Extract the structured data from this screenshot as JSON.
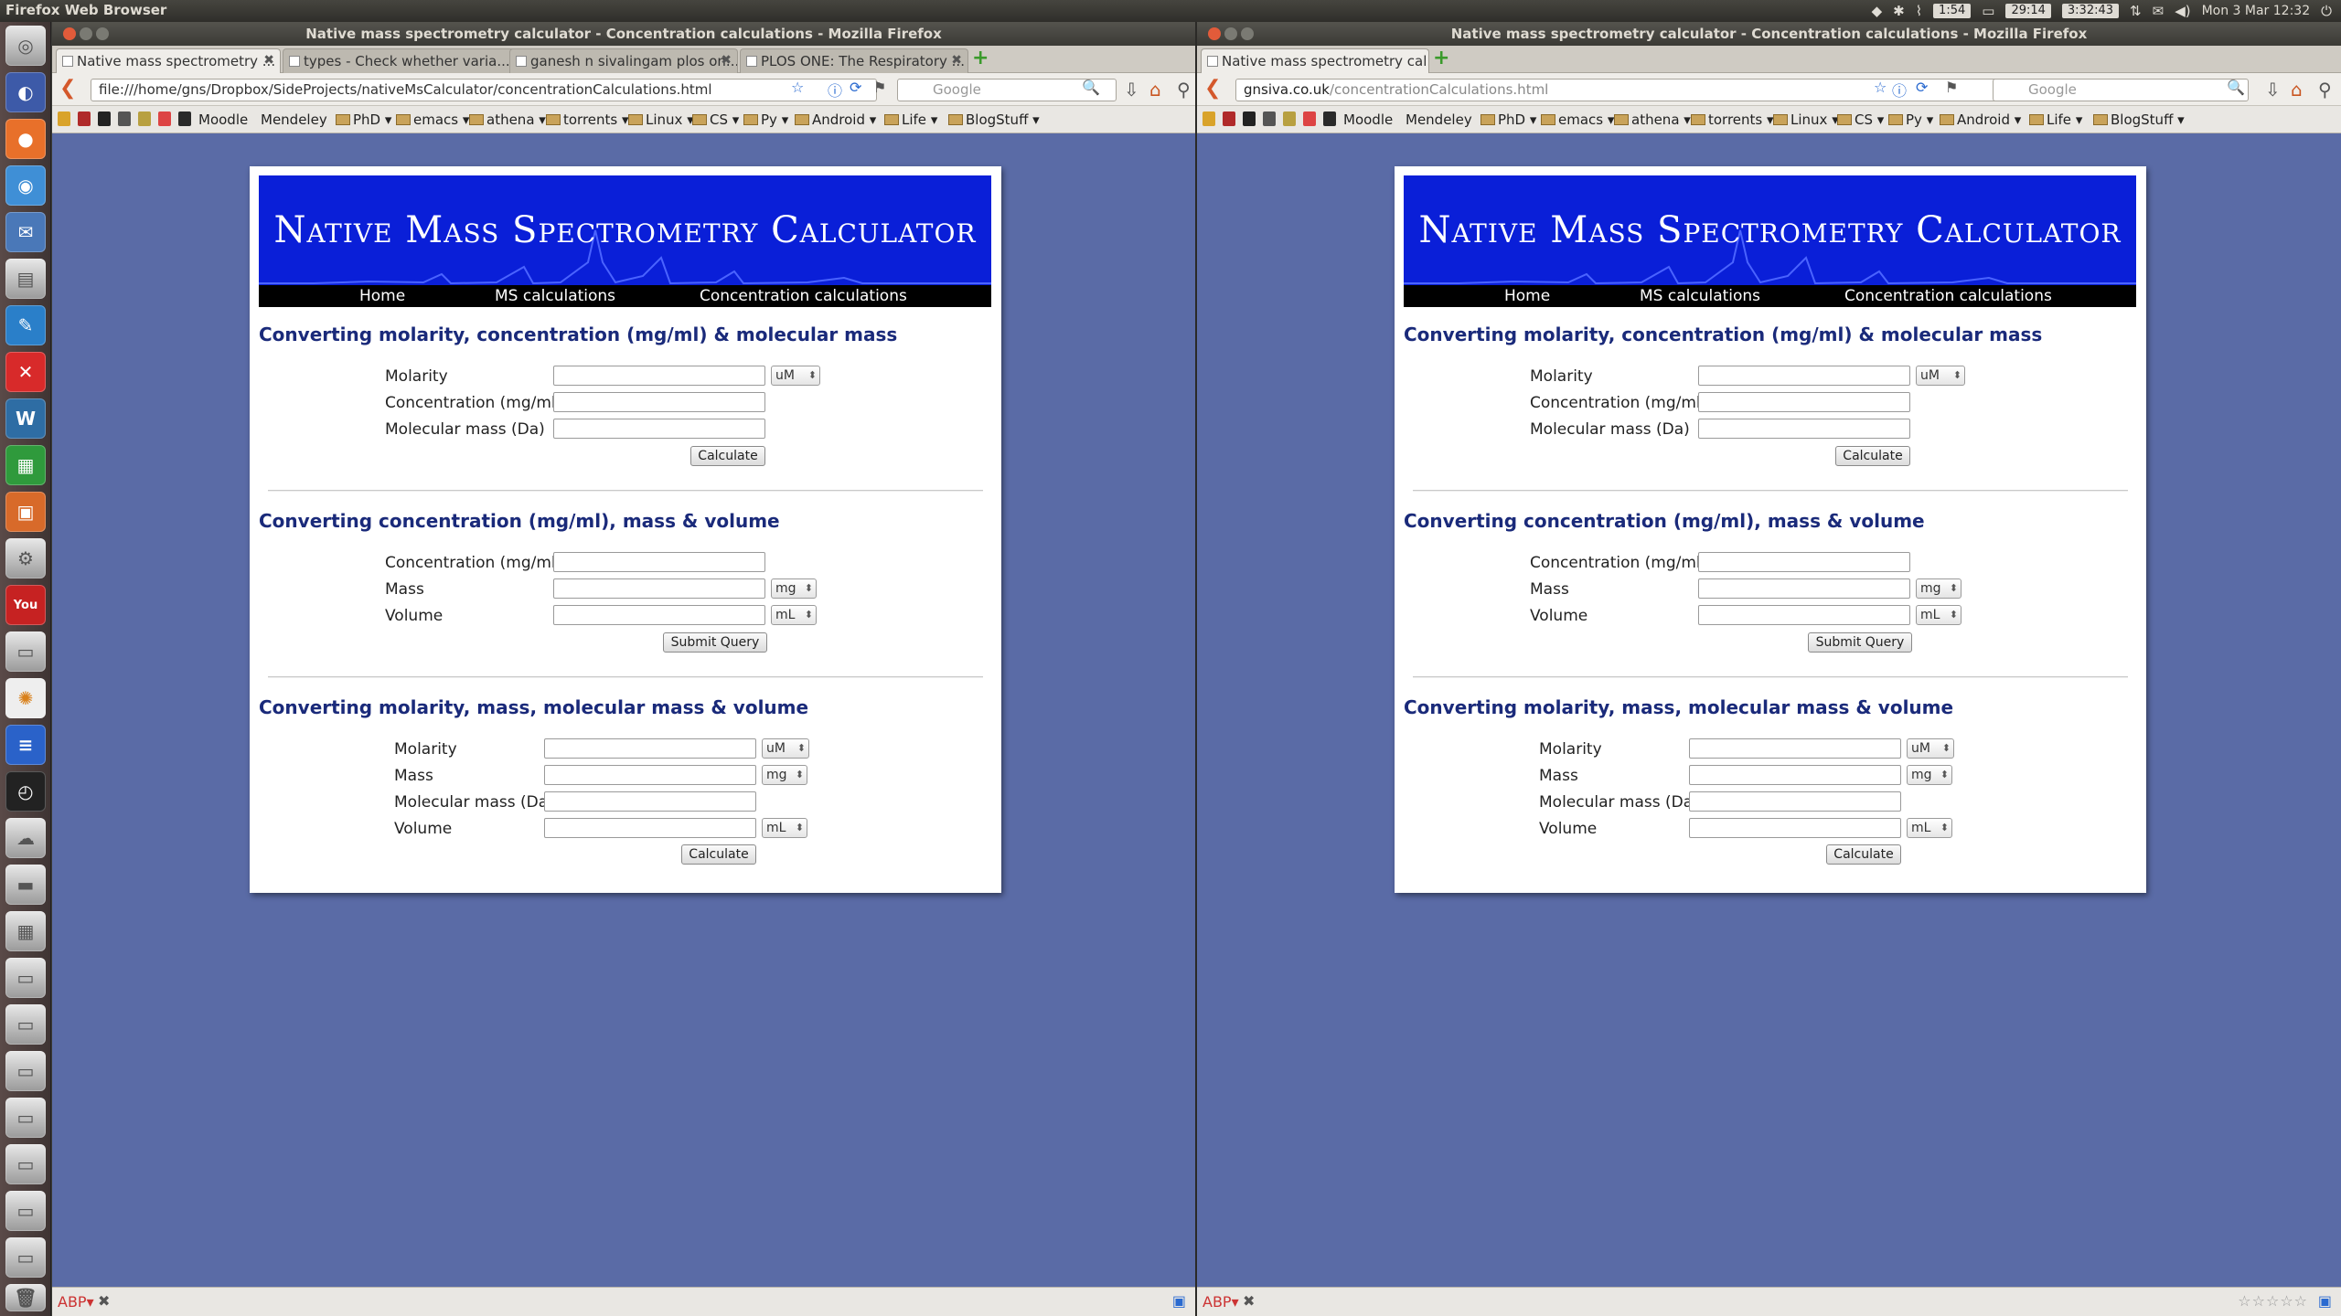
{
  "topbar": {
    "title": "Firefox Web Browser",
    "battery": "1:54",
    "timer": "29:14",
    "clock2": "3:32:43",
    "datetime": "Mon 3 Mar 12:32"
  },
  "launcher": {
    "icons": [
      "dash-icon",
      "browser-icon",
      "firefox-icon",
      "chromium-icon",
      "thunderbird-icon",
      "files-icon",
      "writer-icon",
      "xmind-icon",
      "wordpress-icon",
      "calc-icon",
      "impress-icon",
      "settings-icon",
      "youtube-icon",
      "remote-desktop-icon",
      "software-center-icon",
      "docs-icon",
      "clock-icon",
      "cloud-icon",
      "scanner-icon",
      "workspace-icon",
      "drive-icon",
      "drive-icon",
      "drive-icon",
      "drive-icon",
      "drive-icon",
      "drive-icon",
      "drive-icon",
      "trash-icon"
    ]
  },
  "left": {
    "window_title": "Native mass spectrometry calculator - Concentration calculations - Mozilla Firefox",
    "tabs": [
      "Native mass spectrometry ...",
      "types - Check whether varia...",
      "ganesh n sivalingam plos on...",
      "PLOS ONE: The Respiratory ..."
    ],
    "url": "file:///home/gns/Dropbox/SideProjects/nativeMsCalculator/concentrationCalculations.html",
    "search_placeholder": "Google"
  },
  "right": {
    "window_title": "Native mass spectrometry calculator - Concentration calculations - Mozilla Firefox",
    "tabs": [
      "Native mass spectrometry cal..."
    ],
    "url_domain": "gnsiva.co.uk",
    "url_path": "/concentrationCalculations.html",
    "search_placeholder": "Google"
  },
  "bookmarks": [
    "Moodle",
    "Mendeley",
    "PhD",
    "emacs",
    "athena",
    "torrents",
    "Linux",
    "CS",
    "Py",
    "Android",
    "Life",
    "BlogStuff"
  ],
  "page": {
    "banner_title": "Native Mass Spectrometry Calculator",
    "menu": {
      "home": "Home",
      "ms": "MS calculations",
      "conc": "Concentration calculations"
    },
    "sections": [
      {
        "title": "Converting molarity, concentration (mg/ml) & molecular mass",
        "labels": [
          "Molarity",
          "Concentration (mg/ml)",
          "Molecular mass (Da)"
        ],
        "units": [
          "uM"
        ],
        "button": "Calculate"
      },
      {
        "title": "Converting concentration (mg/ml), mass & volume",
        "labels": [
          "Concentration (mg/ml)",
          "Mass",
          "Volume"
        ],
        "units": [
          "mg",
          "mL"
        ],
        "button": "Submit Query"
      },
      {
        "title": "Converting molarity, mass, molecular mass & volume",
        "labels": [
          "Molarity",
          "Mass",
          "Molecular mass (Da)",
          "Volume"
        ],
        "units": [
          "uM",
          "mg",
          "mL"
        ],
        "button": "Calculate"
      }
    ]
  },
  "colors": {
    "page_bg": "#5a6ba6",
    "banner": "#0a1fd8",
    "heading": "#1a2a7a"
  }
}
